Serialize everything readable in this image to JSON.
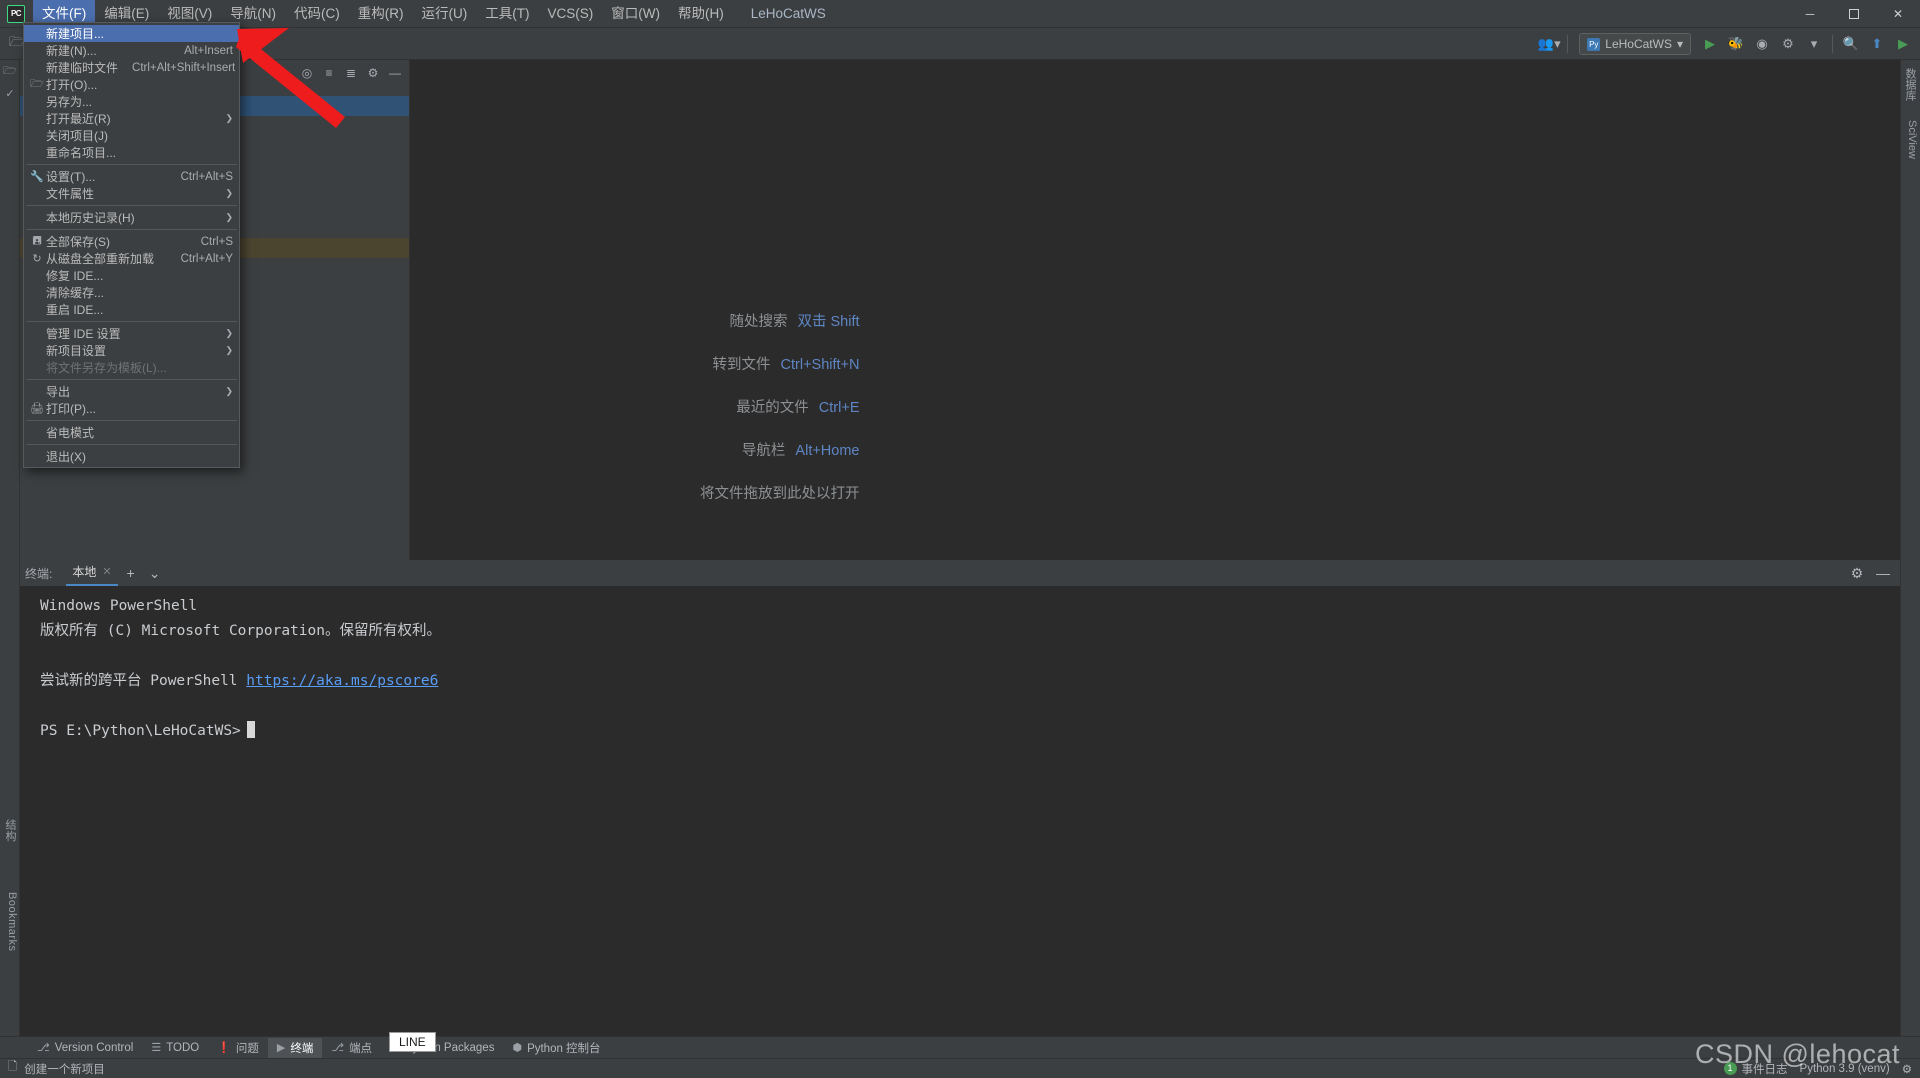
{
  "window": {
    "app_logo": "PC",
    "title": "LeHoCatWS",
    "controls": {
      "minimize": "─",
      "maximize": "☐",
      "close": "✕"
    }
  },
  "menubar": {
    "items": [
      {
        "label": "文件(F)",
        "mnemonic": "F",
        "active": true
      },
      {
        "label": "编辑(E)",
        "mnemonic": "E",
        "active": false
      },
      {
        "label": "视图(V)",
        "mnemonic": "V",
        "active": false
      },
      {
        "label": "导航(N)",
        "mnemonic": "N",
        "active": false
      },
      {
        "label": "代码(C)",
        "mnemonic": "C",
        "active": false
      },
      {
        "label": "重构(R)",
        "mnemonic": "R",
        "active": false
      },
      {
        "label": "运行(U)",
        "mnemonic": "U",
        "active": false
      },
      {
        "label": "工具(T)",
        "mnemonic": "T",
        "active": false
      },
      {
        "label": "VCS(S)",
        "mnemonic": "S",
        "active": false
      },
      {
        "label": "窗口(W)",
        "mnemonic": "W",
        "active": false
      },
      {
        "label": "帮助(H)",
        "mnemonic": "H",
        "active": false
      }
    ]
  },
  "file_menu": {
    "items": [
      {
        "label": "新建项目...",
        "shortcut": "",
        "icon": "",
        "highlight": true,
        "submenu": false,
        "disabled": false
      },
      {
        "label": "新建(N)...",
        "shortcut": "Alt+Insert",
        "icon": "",
        "highlight": false,
        "submenu": false,
        "disabled": false
      },
      {
        "label": "新建临时文件",
        "shortcut": "Ctrl+Alt+Shift+Insert",
        "icon": "",
        "highlight": false,
        "submenu": false,
        "disabled": false
      },
      {
        "label": "打开(O)...",
        "shortcut": "",
        "icon": "folder-open-icon",
        "glyph": "🗁",
        "highlight": false,
        "submenu": false,
        "disabled": false
      },
      {
        "label": "另存为...",
        "shortcut": "",
        "icon": "",
        "highlight": false,
        "submenu": false,
        "disabled": false
      },
      {
        "label": "打开最近(R)",
        "shortcut": "",
        "icon": "",
        "highlight": false,
        "submenu": true,
        "disabled": false
      },
      {
        "label": "关闭项目(J)",
        "shortcut": "",
        "icon": "",
        "highlight": false,
        "submenu": false,
        "disabled": false
      },
      {
        "label": "重命名项目...",
        "shortcut": "",
        "icon": "",
        "highlight": false,
        "submenu": false,
        "disabled": false
      },
      {
        "separator": true
      },
      {
        "label": "设置(T)...",
        "shortcut": "Ctrl+Alt+S",
        "icon": "wrench-icon",
        "glyph": "🔧",
        "highlight": false,
        "submenu": false,
        "disabled": false
      },
      {
        "label": "文件属性",
        "shortcut": "",
        "icon": "",
        "highlight": false,
        "submenu": true,
        "disabled": false
      },
      {
        "separator": true
      },
      {
        "label": "本地历史记录(H)",
        "shortcut": "",
        "icon": "",
        "highlight": false,
        "submenu": true,
        "disabled": false
      },
      {
        "separator": true
      },
      {
        "label": "全部保存(S)",
        "shortcut": "Ctrl+S",
        "icon": "save-icon",
        "glyph": "💾",
        "highlight": false,
        "submenu": false,
        "disabled": false
      },
      {
        "label": "从磁盘全部重新加载",
        "shortcut": "Ctrl+Alt+Y",
        "icon": "refresh-icon",
        "glyph": "↻",
        "highlight": false,
        "submenu": false,
        "disabled": false
      },
      {
        "label": "修复 IDE...",
        "shortcut": "",
        "icon": "",
        "highlight": false,
        "submenu": false,
        "disabled": false
      },
      {
        "label": "清除缓存...",
        "shortcut": "",
        "icon": "",
        "highlight": false,
        "submenu": false,
        "disabled": false
      },
      {
        "label": "重启 IDE...",
        "shortcut": "",
        "icon": "",
        "highlight": false,
        "submenu": false,
        "disabled": false
      },
      {
        "separator": true
      },
      {
        "label": "管理 IDE 设置",
        "shortcut": "",
        "icon": "",
        "highlight": false,
        "submenu": true,
        "disabled": false
      },
      {
        "label": "新项目设置",
        "shortcut": "",
        "icon": "",
        "highlight": false,
        "submenu": true,
        "disabled": false
      },
      {
        "label": "将文件另存为模板(L)...",
        "shortcut": "",
        "icon": "",
        "highlight": false,
        "submenu": false,
        "disabled": true
      },
      {
        "separator": true
      },
      {
        "label": "导出",
        "shortcut": "",
        "icon": "",
        "highlight": false,
        "submenu": true,
        "disabled": false
      },
      {
        "label": "打印(P)...",
        "shortcut": "",
        "icon": "printer-icon",
        "glyph": "🖨",
        "highlight": false,
        "submenu": false,
        "disabled": false
      },
      {
        "separator": true
      },
      {
        "label": "省电模式",
        "shortcut": "",
        "icon": "",
        "highlight": false,
        "submenu": false,
        "disabled": false
      },
      {
        "separator": true
      },
      {
        "label": "退出(X)",
        "shortcut": "",
        "icon": "",
        "highlight": false,
        "submenu": false,
        "disabled": false
      }
    ]
  },
  "toolbar": {
    "left_icons": [
      "project-icon",
      "structure-icon"
    ],
    "panel_icons": [
      "collapse-icon",
      "expand-icon",
      "sort-icon",
      "gear-icon",
      "hide-icon"
    ],
    "run_config": {
      "badge": "Py",
      "name": "LeHoCatWS",
      "caret": "▾"
    },
    "right_icons": [
      "run-icon",
      "debug-icon",
      "coverage-icon",
      "profile-icon",
      "more-icon",
      "search-icon",
      "update-icon",
      "play-icon"
    ],
    "account_icon": "user-account-icon"
  },
  "editor": {
    "tips": [
      {
        "label": "随处搜索",
        "key": "双击 Shift"
      },
      {
        "label": "转到文件",
        "key": "Ctrl+Shift+N"
      },
      {
        "label": "最近的文件",
        "key": "Ctrl+E"
      },
      {
        "label": "导航栏",
        "key": "Alt+Home"
      }
    ],
    "drop_hint": "将文件拖放到此处以打开"
  },
  "terminal": {
    "title": "终端:",
    "tab_label": "本地",
    "tab_close": "✕",
    "add_button": "+",
    "dropdown_button": "⌄",
    "settings_icon": "gear-icon",
    "hide_icon": "minimize-icon",
    "lines": [
      {
        "text": "Windows PowerShell",
        "link": ""
      },
      {
        "text": "版权所有 (C) Microsoft Corporation。保留所有权利。",
        "link": ""
      },
      {
        "blank": true
      },
      {
        "text": "尝试新的跨平台 PowerShell ",
        "link": "https://aka.ms/pscore6"
      },
      {
        "blank": true
      },
      {
        "text": "PS E:\\Python\\LeHoCatWS>",
        "link": "",
        "cursor": true
      }
    ]
  },
  "tool_windows": [
    {
      "label": "Version Control",
      "icon": "branch-icon",
      "glyph": "⎇",
      "active": false
    },
    {
      "label": "TODO",
      "icon": "list-icon",
      "glyph": "☰",
      "active": false
    },
    {
      "label": "问题",
      "icon": "warning-icon",
      "glyph": "❗",
      "active": false
    },
    {
      "label": "终端",
      "icon": "terminal-icon",
      "glyph": "▶",
      "active": true
    },
    {
      "label": "端点",
      "icon": "endpoints-icon",
      "glyph": "⎇",
      "active": false
    },
    {
      "label": "Python Packages",
      "icon": "packages-icon",
      "glyph": "❖",
      "active": false
    },
    {
      "label": "Python 控制台",
      "icon": "python-icon",
      "glyph": "⬢",
      "active": false
    }
  ],
  "left_strip_labels": [
    "结构",
    "Bookmarks"
  ],
  "right_strip_labels": [
    "数据库",
    "SciView"
  ],
  "status_bar": {
    "left_icon": "new-project-icon",
    "left_text": "创建一个新项目",
    "event_badge": "1",
    "event_label": "事件日志",
    "interpreter": "Python 3.9 (venv)",
    "settings_icon": "gear-icon"
  },
  "tooltip": {
    "text": "LINE"
  },
  "watermark": {
    "text": "CSDN @lehocat"
  },
  "colors": {
    "accent_blue": "#4b6eaf",
    "link_blue": "#589df6",
    "tip_key": "#5e86c4",
    "bg_panel": "#3c3f41",
    "bg_editor": "#2b2b2b",
    "arrow_red": "#ee1c1c",
    "badge_green": "#499c54"
  }
}
